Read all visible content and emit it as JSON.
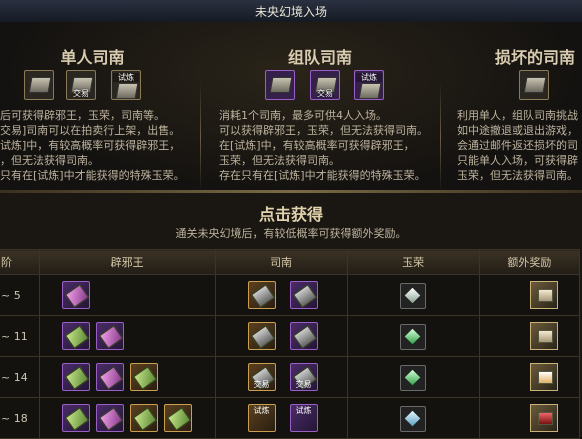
{
  "window": {
    "title": "未央幻境入场",
    "right_text": "▢ ..."
  },
  "columns": [
    {
      "title": "单人司南",
      "icons": [
        {
          "label": ""
        },
        {
          "label": "交易"
        },
        {
          "label_top": "试炼"
        }
      ],
      "desc": "后可获得辟邪王，玉荣，司南等。\n交易]司南可以在拍卖行上架，出售。\n试炼]中，有较高概率可获得辟邪王，\n，但无法获得司南。\n只有在[试炼]中才能获得的特殊玉荣。"
    },
    {
      "title": "组队司南",
      "icons": [
        {
          "label": ""
        },
        {
          "label": "交易"
        },
        {
          "label_top": "试炼"
        }
      ],
      "desc": "消耗1个司南，最多可供4人入场。\n可以获得辟邪王，玉荣，但无法获得司南。\n在[试炼]中，有较高概率可获得辟邪王，\n玉荣，但无法获得司南。\n存在只有在[试炼]中才能获得的特殊玉荣。"
    },
    {
      "title": "损坏的司南",
      "icons": [
        {
          "label": ""
        }
      ],
      "desc": "利用单人，组队司南挑战\n如中途撤退或退出游戏，\n会通过邮件返还损坏的司\n只能单人入场，可获得辟\n玉荣，但无法获得司南。"
    }
  ],
  "reward": {
    "title": "点击获得",
    "subtitle": "通关未央幻境后，有较低概率可获得额外奖励。",
    "headers": [
      "阶",
      "辟邪王",
      "司南",
      "玉荣",
      "额外奖励"
    ],
    "rows": [
      {
        "stage": "~ 5",
        "bixie": 1,
        "sinan": [
          {
            "label": ""
          },
          {
            "label": ""
          }
        ],
        "gem": "white",
        "extra": "box"
      },
      {
        "stage": "~ 11",
        "bixie": 2,
        "sinan": [
          {
            "label": ""
          },
          {
            "label": ""
          }
        ],
        "gem": "white",
        "extra": "box"
      },
      {
        "stage": "~ 14",
        "bixie": 3,
        "sinan": [
          {
            "label": "交易"
          },
          {
            "label": "交易"
          }
        ],
        "gem": "green",
        "extra": "cube"
      },
      {
        "stage": "~ 18",
        "bixie": 4,
        "sinan": [
          {
            "label_top": "试炼"
          },
          {
            "label_top": "试炼"
          }
        ],
        "gem": "blue",
        "extra": "red"
      }
    ]
  }
}
